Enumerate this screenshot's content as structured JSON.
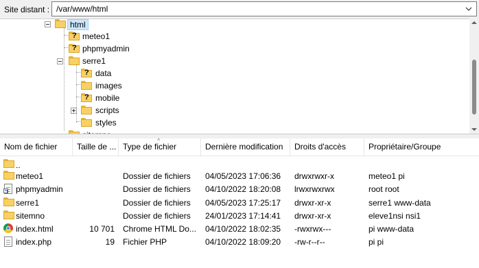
{
  "remote": {
    "label": "Site distant :",
    "path": "/var/www/html"
  },
  "tree": {
    "nodes": [
      {
        "label": "html"
      },
      {
        "label": "meteo1"
      },
      {
        "label": "phpmyadmin"
      },
      {
        "label": "serre1"
      },
      {
        "label": "data"
      },
      {
        "label": "images"
      },
      {
        "label": "mobile"
      },
      {
        "label": "scripts"
      },
      {
        "label": "styles"
      },
      {
        "label": "sitemno"
      }
    ]
  },
  "list": {
    "headers": [
      "Nom de fichier",
      "Taille de ...",
      "Type de fichier",
      "Dernière modification",
      "Droits d'accès",
      "Propriétaire/Groupe"
    ],
    "rows": [
      {
        "name": "..",
        "size": "",
        "type": "",
        "modified": "",
        "perms": "",
        "owner": ""
      },
      {
        "name": "meteo1",
        "size": "",
        "type": "Dossier de fichiers",
        "modified": "04/05/2023 17:06:36",
        "perms": "drwxrwxr-x",
        "owner": "meteo1 pi"
      },
      {
        "name": "phpmyadmin",
        "size": "",
        "type": "Dossier de fichiers",
        "modified": "04/10/2022 18:20:08",
        "perms": "lrwxrwxrwx",
        "owner": "root root"
      },
      {
        "name": "serre1",
        "size": "",
        "type": "Dossier de fichiers",
        "modified": "04/05/2023 17:25:17",
        "perms": "drwxr-xr-x",
        "owner": "serre1 www-data"
      },
      {
        "name": "sitemno",
        "size": "",
        "type": "Dossier de fichiers",
        "modified": "24/01/2023 17:14:41",
        "perms": "drwxr-xr-x",
        "owner": "eleve1nsi nsi1"
      },
      {
        "name": "index.html",
        "size": "10 701",
        "type": "Chrome HTML Do...",
        "modified": "04/10/2022 18:02:35",
        "perms": "-rwxrwx---",
        "owner": "pi www-data"
      },
      {
        "name": "index.php",
        "size": "19",
        "type": "Fichier PHP",
        "modified": "04/10/2022 18:09:20",
        "perms": "-rw-r--r--",
        "owner": "pi pi"
      }
    ]
  },
  "icons": {
    "folder": "folder-icon",
    "unknown_folder": "unknown-folder-icon",
    "chrome": "chrome-icon",
    "document": "document-icon"
  },
  "colors": {
    "selection": "#cce8ff",
    "folder": "#f8d165"
  }
}
